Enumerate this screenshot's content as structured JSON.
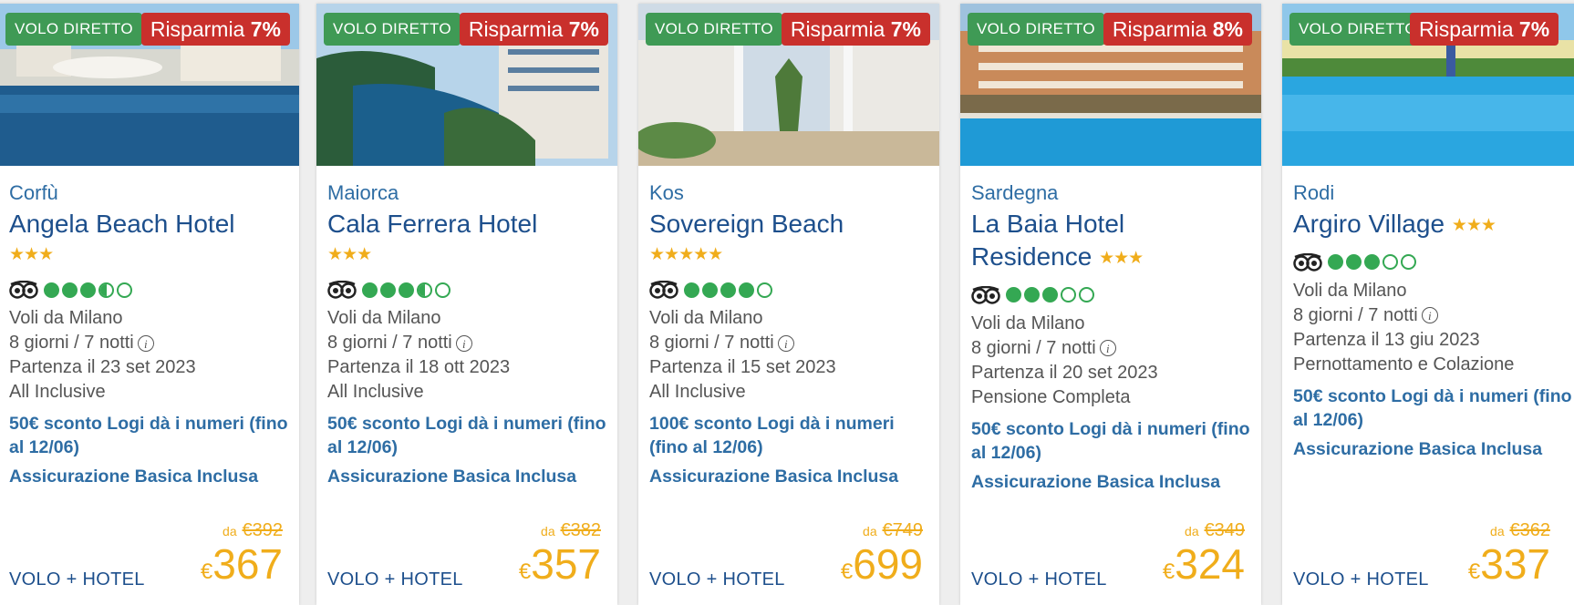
{
  "direct_badge": "VOLO DIRETTO",
  "product_label": "VOLO + HOTEL",
  "from_label": "da",
  "currency": "€",
  "save_prefix": "Risparmia",
  "cards": [
    {
      "region": "Corfù",
      "name": "Angela Beach Hotel",
      "stars": "★★★",
      "rating_dots": [
        1,
        1,
        1,
        0.5,
        0
      ],
      "flights": "Voli da Milano",
      "duration": "8 giorni / 7 notti",
      "departure": "Partenza il 23 set 2023",
      "board": "All Inclusive",
      "promo": "50€ sconto Logi dà i numeri (fino al 12/06)",
      "insurance": "Assicurazione Basica Inclusa",
      "save": "7%",
      "old_price": "€392",
      "price": "367"
    },
    {
      "region": "Maiorca",
      "name": "Cala Ferrera Hotel",
      "stars": "★★★",
      "rating_dots": [
        1,
        1,
        1,
        0.5,
        0
      ],
      "flights": "Voli da Milano",
      "duration": "8 giorni / 7 notti",
      "departure": "Partenza il 18 ott 2023",
      "board": "All Inclusive",
      "promo": "50€ sconto Logi dà i numeri (fino al 12/06)",
      "insurance": "Assicurazione Basica Inclusa",
      "save": "7%",
      "old_price": "€382",
      "price": "357"
    },
    {
      "region": "Kos",
      "name": "Sovereign Beach",
      "stars": "★★★★★",
      "rating_dots": [
        1,
        1,
        1,
        1,
        0
      ],
      "flights": "Voli da Milano",
      "duration": "8 giorni / 7 notti",
      "departure": "Partenza il 15 set 2023",
      "board": "All Inclusive",
      "promo": "100€ sconto Logi dà i numeri (fino al 12/06)",
      "insurance": "Assicurazione Basica Inclusa",
      "save": "7%",
      "old_price": "€749",
      "price": "699"
    },
    {
      "region": "Sardegna",
      "name": "La Baia Hotel Residence",
      "stars": "★★★",
      "rating_dots": [
        1,
        1,
        1,
        0,
        0
      ],
      "flights": "Voli da Milano",
      "duration": "8 giorni / 7 notti",
      "departure": "Partenza il 20 set 2023",
      "board": "Pensione Completa",
      "promo": "50€ sconto Logi dà i numeri (fino al 12/06)",
      "insurance": "Assicurazione Basica Inclusa",
      "save": "8%",
      "old_price": "€349",
      "price": "324"
    },
    {
      "region": "Rodi",
      "name": "Argiro Village",
      "stars": "★★★",
      "rating_dots": [
        1,
        1,
        1,
        0,
        0
      ],
      "flights": "Voli da Milano",
      "duration": "8 giorni / 7 notti",
      "departure": "Partenza il 13 giu 2023",
      "board": "Pernottamento e Colazione",
      "promo": "50€ sconto Logi dà i numeri (fino al 12/06)",
      "insurance": "Assicurazione Basica Inclusa",
      "save": "7%",
      "old_price": "€362",
      "price": "337"
    }
  ]
}
